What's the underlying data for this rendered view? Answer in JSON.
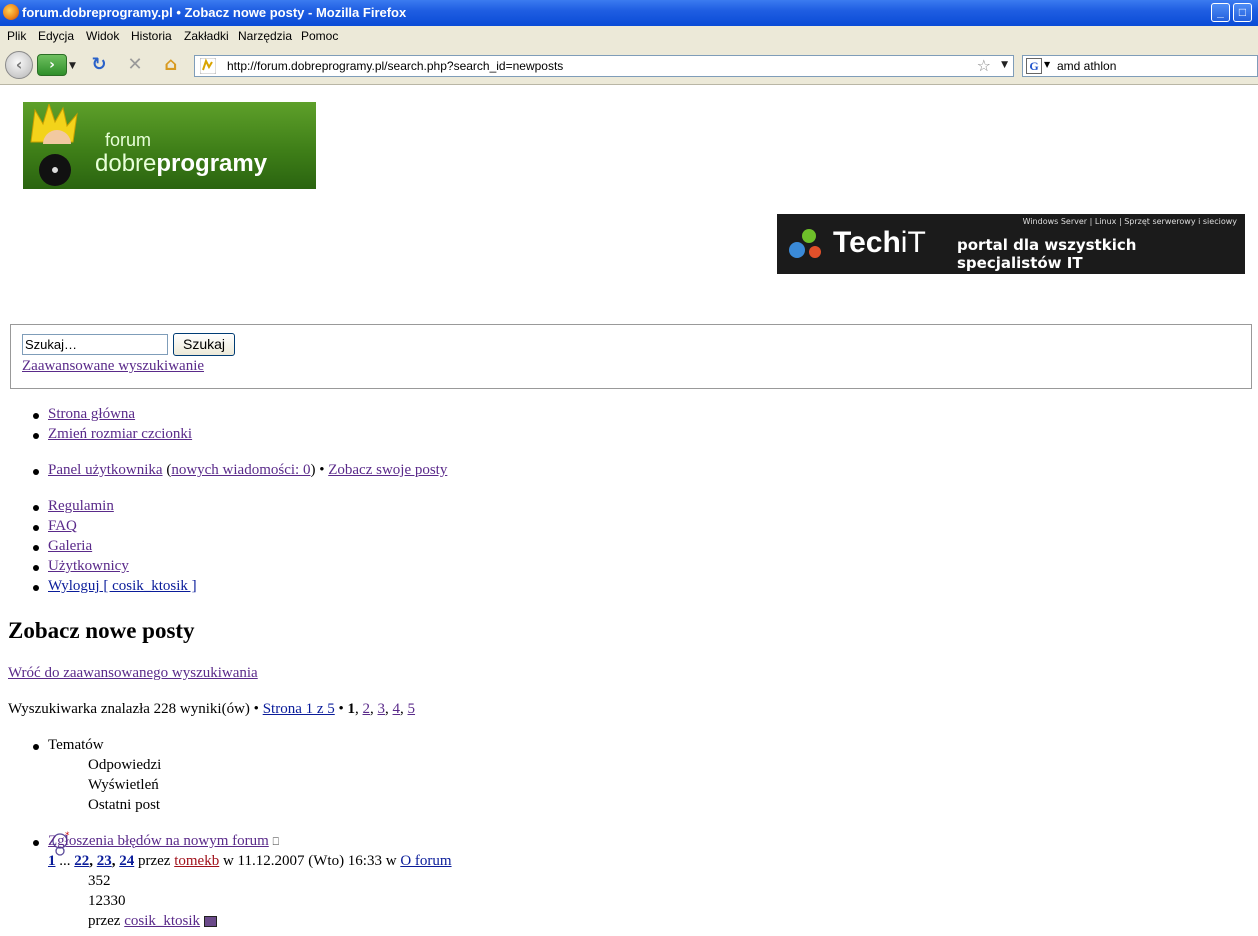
{
  "window": {
    "title": "forum.dobreprogramy.pl • Zobacz nowe posty - Mozilla Firefox"
  },
  "menu": [
    "Plik",
    "Edycja",
    "Widok",
    "Historia",
    "Zakładki",
    "Narzędzia",
    "Pomoc"
  ],
  "navbar": {
    "url": "http://forum.dobreprogramy.pl/search.php?search_id=newposts",
    "search_query": "amd athlon"
  },
  "logo": {
    "line1": "forum",
    "brand_light": "dobre",
    "brand_bold": "programy"
  },
  "banner": {
    "top_text": "Windows Server | Linux | Sprzęt serwerowy i sieciowy",
    "brand_a": "Tech",
    "brand_b": "iT",
    "tagline": "portal dla wszystkich specjalistów IT"
  },
  "search": {
    "input_value": "Szukaj…",
    "button": "Szukaj",
    "advanced": "Zaawansowane wyszukiwanie"
  },
  "nav1": [
    "Strona główna",
    "Zmień rozmiar czcionki"
  ],
  "user_panel": {
    "panel": "Panel użytkownika",
    "open_paren": " (",
    "messages": "nowych wiadomości: 0",
    "close_paren": ") • ",
    "own_posts": "Zobacz swoje posty"
  },
  "nav2": [
    "Regulamin",
    "FAQ",
    "Galeria",
    "Użytkownicy",
    "Wyloguj [ cosik_ktosik ]"
  ],
  "page_title": "Zobacz nowe posty",
  "back_link": "Wróć do zaawansowanego wyszukiwania",
  "results": {
    "prefix": "Wyszukiwarka znalazła 228 wyniki(ów) • ",
    "page_label": "Strona 1 z 5",
    "sep": " • ",
    "current": "1",
    "pages": [
      "2",
      "3",
      "4",
      "5"
    ]
  },
  "headers": {
    "topics": "Tematów",
    "replies": "Odpowiedzi",
    "views": "Wyświetleń",
    "last_post": "Ostatni post"
  },
  "topic": {
    "title": "Zgłoszenia błędów na nowym forum",
    "pages_first": "1",
    "ellipsis": " ... ",
    "pages_last": [
      "22",
      "23",
      "24"
    ],
    "by": " przez ",
    "author": "tomekb",
    "date_text": " w 11.12.2007 (Wto) 16:33 w ",
    "forum": "O forum",
    "replies": "352",
    "views": "12330",
    "last_by": "przez ",
    "last_author": "cosik_ktosik"
  },
  "colors": {
    "titlebar": "#0a4bd6",
    "chrome": "#ece9d8",
    "link_visited": "#5a2a8a",
    "link_blue": "#0a1c9a",
    "author_red": "#a0101a"
  }
}
